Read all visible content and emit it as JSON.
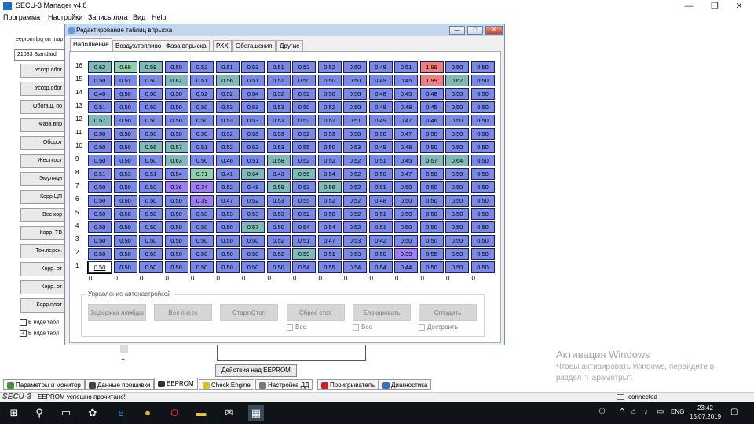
{
  "window": {
    "title": "SECU-3 Manager v4.8",
    "controls": [
      "—",
      "❐",
      "✕"
    ]
  },
  "menu": [
    "Программа",
    "Настройки",
    "Запись лога",
    "Вид",
    "Help"
  ],
  "left_panel": {
    "eeprom_label": "eeprom lpg on map",
    "profile_value": "21083 Standard",
    "buttons": [
      "Ускор.обог",
      "Ускор.обог",
      "Обогащ. по",
      "Фаза впр",
      "Оборот",
      "Жесткост",
      "Эмуляци",
      "Корр.ЦП",
      "Вес кор",
      "Корр. ТВ",
      "Точ.перек.",
      "Корр. от",
      "Корр. от",
      "Корр.плот"
    ],
    "checkboxes": [
      {
        "label": "В виде табл",
        "checked": false
      },
      {
        "label": "В виде табл",
        "checked": true
      }
    ]
  },
  "dialog": {
    "title": "Редактирование таблиц впрыска",
    "controls": [
      "—",
      "□",
      "✕"
    ],
    "tabs": [
      "Наполнение",
      "Воздух/топливо",
      "Фаза впрыска",
      "РХХ",
      "Обогащения",
      "Другие"
    ],
    "active_tab": 0,
    "row_labels": [
      "16",
      "15",
      "14",
      "13",
      "12",
      "11",
      "10",
      "9",
      "8",
      "7",
      "6",
      "5",
      "4",
      "3",
      "2",
      "1"
    ],
    "col_labels": [
      "0",
      "0",
      "0",
      "0",
      "0",
      "0",
      "0",
      "0",
      "0",
      "0",
      "0",
      "0",
      "0",
      "0",
      "0",
      "0"
    ],
    "grid": [
      [
        "0.62",
        "0.69",
        "0.59",
        "0.50",
        "0.52",
        "0.51",
        "0.53",
        "0.51",
        "0.52",
        "0.52",
        "0.50",
        "0.48",
        "0.51",
        "1.99",
        "0.50",
        "0.50"
      ],
      [
        "0.50",
        "0.51",
        "0.50",
        "0.62",
        "0.51",
        "0.56",
        "0.51",
        "0.51",
        "0.50",
        "0.50",
        "0.50",
        "0.49",
        "0.45",
        "1.99",
        "0.62",
        "0.50"
      ],
      [
        "0.40",
        "0.50",
        "0.50",
        "0.50",
        "0.52",
        "0.52",
        "0.54",
        "0.52",
        "0.52",
        "0.50",
        "0.50",
        "0.48",
        "0.45",
        "0.48",
        "0.50",
        "0.50"
      ],
      [
        "0.51",
        "0.50",
        "0.50",
        "0.50",
        "0.50",
        "0.53",
        "0.53",
        "0.53",
        "0.50",
        "0.52",
        "0.50",
        "0.48",
        "0.48",
        "0.45",
        "0.50",
        "0.50"
      ],
      [
        "0.57",
        "0.50",
        "0.50",
        "0.50",
        "0.50",
        "0.53",
        "0.53",
        "0.53",
        "0.52",
        "0.52",
        "0.51",
        "0.49",
        "0.47",
        "0.46",
        "0.50",
        "0.50"
      ],
      [
        "0.50",
        "0.50",
        "0.50",
        "0.50",
        "0.50",
        "0.52",
        "0.53",
        "0.53",
        "0.52",
        "0.53",
        "0.50",
        "0.50",
        "0.47",
        "0.50",
        "0.50",
        "0.50"
      ],
      [
        "0.50",
        "0.50",
        "0.56",
        "0.57",
        "0.51",
        "0.52",
        "0.52",
        "0.53",
        "0.55",
        "0.50",
        "0.53",
        "0.49",
        "0.48",
        "0.50",
        "0.50",
        "0.50"
      ],
      [
        "0.50",
        "0.50",
        "0.50",
        "0.63",
        "0.50",
        "0.46",
        "0.51",
        "0.58",
        "0.52",
        "0.52",
        "0.52",
        "0.51",
        "0.45",
        "0.57",
        "0.64",
        "0.50"
      ],
      [
        "0.51",
        "0.53",
        "0.51",
        "0.54",
        "0.71",
        "0.41",
        "0.64",
        "0.43",
        "0.56",
        "0.54",
        "0.52",
        "0.50",
        "0.47",
        "0.50",
        "0.50",
        "0.50"
      ],
      [
        "0.50",
        "0.50",
        "0.50",
        "0.36",
        "0.34",
        "0.52",
        "0.48",
        "0.59",
        "0.53",
        "0.56",
        "0.52",
        "0.51",
        "0.50",
        "0.50",
        "0.50",
        "0.50"
      ],
      [
        "0.50",
        "0.50",
        "0.50",
        "0.50",
        "0.39",
        "0.47",
        "0.52",
        "0.53",
        "0.55",
        "0.52",
        "0.52",
        "0.48",
        "0.50",
        "0.50",
        "0.50",
        "0.50"
      ],
      [
        "0.50",
        "0.50",
        "0.50",
        "0.50",
        "0.50",
        "0.53",
        "0.53",
        "0.53",
        "0.52",
        "0.50",
        "0.52",
        "0.51",
        "0.50",
        "0.50",
        "0.50",
        "0.50"
      ],
      [
        "0.50",
        "0.50",
        "0.50",
        "0.50",
        "0.50",
        "0.50",
        "0.57",
        "0.50",
        "0.54",
        "0.54",
        "0.52",
        "0.51",
        "0.50",
        "0.50",
        "0.50",
        "0.50"
      ],
      [
        "0.50",
        "0.50",
        "0.50",
        "0.50",
        "0.50",
        "0.50",
        "0.50",
        "0.52",
        "0.51",
        "0.47",
        "0.53",
        "0.42",
        "0.50",
        "0.50",
        "0.50",
        "0.50"
      ],
      [
        "0.50",
        "0.50",
        "0.50",
        "0.50",
        "0.50",
        "0.50",
        "0.50",
        "0.52",
        "0.59",
        "0.51",
        "0.53",
        "0.50",
        "0.39",
        "0.55",
        "0.50",
        "0.50"
      ],
      [
        "0.50",
        "0.50",
        "0.50",
        "0.50",
        "0.50",
        "0.50",
        "0.50",
        "0.50",
        "0.54",
        "0.55",
        "0.54",
        "0.54",
        "0.44",
        "0.50",
        "0.50",
        "0.50"
      ]
    ],
    "selected_cell": {
      "row": 15,
      "col": 0
    },
    "colors": {
      "base": "#7b89e6",
      "low": "#9b7ef0",
      "teal": "#7fb9b8",
      "green": "#8fd1a8",
      "red": "#f08080",
      "selected": "#ffffff"
    },
    "auto_tuning": {
      "legend": "Управление автонастройкой",
      "buttons": [
        "Задержка лямбды",
        "Вес ячеек",
        "Старт/Стоп",
        "Сброс стат.",
        "Блокировать",
        "Сгладить"
      ],
      "checkboxes": [
        "Все",
        "Все",
        "Достроить"
      ]
    }
  },
  "eeprom_actions_label": "Действия над EEPROM",
  "bottom_tabs": [
    {
      "label": "Параметры и монитор",
      "icon": "monitor-icon",
      "color": "#4a8f3c"
    },
    {
      "label": "Данные прошивки",
      "icon": "firmware-icon",
      "color": "#444444"
    },
    {
      "label": "EEPROM",
      "icon": "eeprom-icon",
      "color": "#333333"
    },
    {
      "label": "Check Engine",
      "icon": "engine-icon",
      "color": "#d8c21a"
    },
    {
      "label": "Настройка ДД",
      "icon": "wrench-icon",
      "color": "#777777"
    },
    {
      "label": "Проигрыватель",
      "icon": "play-icon",
      "color": "#d02020"
    },
    {
      "label": "Диагностика",
      "icon": "stethoscope-icon",
      "color": "#3a6fc0"
    }
  ],
  "active_bottom_tab": 2,
  "status": {
    "logo": "SECU-3",
    "message": "EEPROM успешно прочитано!",
    "connection": "connected"
  },
  "watermark": {
    "line1": "Активация Windows",
    "line2": "Чтобы активировать Windows, перейдите в",
    "line3": "раздел \"Параметры\"."
  },
  "taskbar": {
    "time": "23:42",
    "date": "15.07.2019",
    "lang": "ENG"
  }
}
